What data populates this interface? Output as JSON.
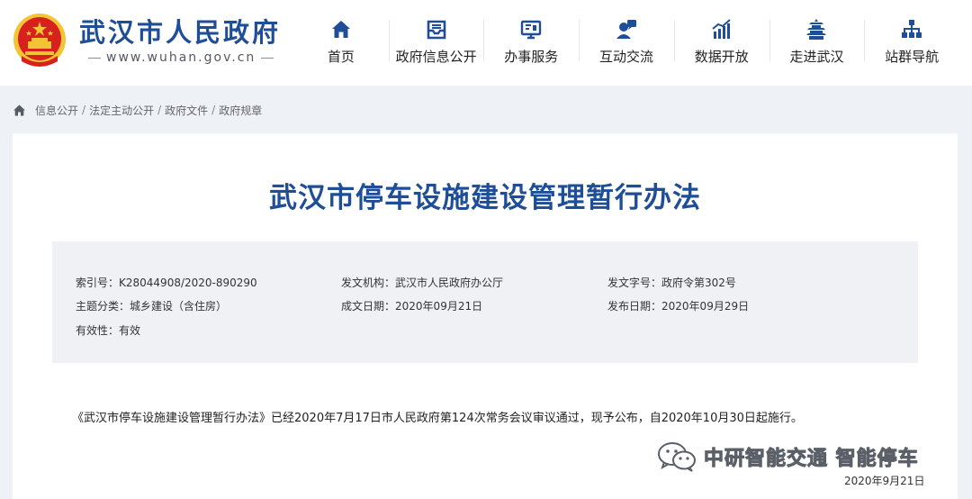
{
  "header": {
    "site_name": "武汉市人民政府",
    "site_url": "www.wuhan.gov.cn",
    "nav": [
      {
        "label": "首页",
        "icon": "home-icon"
      },
      {
        "label": "政府信息公开",
        "icon": "inbox-icon"
      },
      {
        "label": "办事服务",
        "icon": "monitor-icon"
      },
      {
        "label": "互动交流",
        "icon": "chat-user-icon"
      },
      {
        "label": "数据开放",
        "icon": "bar-chart-icon"
      },
      {
        "label": "走进武汉",
        "icon": "tower-icon"
      },
      {
        "label": "站群导航",
        "icon": "sitemap-icon"
      }
    ]
  },
  "breadcrumb": [
    "信息公开",
    "法定主动公开",
    "政府文件",
    "政府规章"
  ],
  "document": {
    "title": "武汉市停车设施建设管理暂行办法",
    "meta": {
      "index_label": "索引号：",
      "index_value": "K28044908/2020-890290",
      "agency_label": "发文机构：",
      "agency_value": "武汉市人民政府办公厅",
      "doc_no_label": "发文字号：",
      "doc_no_value": "政府令第302号",
      "topic_label": "主题分类：",
      "topic_value": "城乡建设（含住房）",
      "created_label": "成文日期：",
      "created_value": "2020年09月21日",
      "published_label": "发布日期：",
      "published_value": "2020年09月29日",
      "validity_label": "有效性：",
      "validity_value": "有效"
    },
    "body": "《武汉市停车设施建设管理暂行办法》已经2020年7月17日市人民政府第124次常务会议审议通过，现予公布，自2020年10月30日起施行。",
    "watermark": "中研智能交通 智能停车",
    "date": "2020年9月21日"
  },
  "colors": {
    "brand": "#1f4e98",
    "header_bg": "#ffffff",
    "page_bg": "#eef1f6",
    "meta_bg": "#eff1f5",
    "emblem_red": "#d8201f",
    "emblem_gold": "#f3c433"
  }
}
